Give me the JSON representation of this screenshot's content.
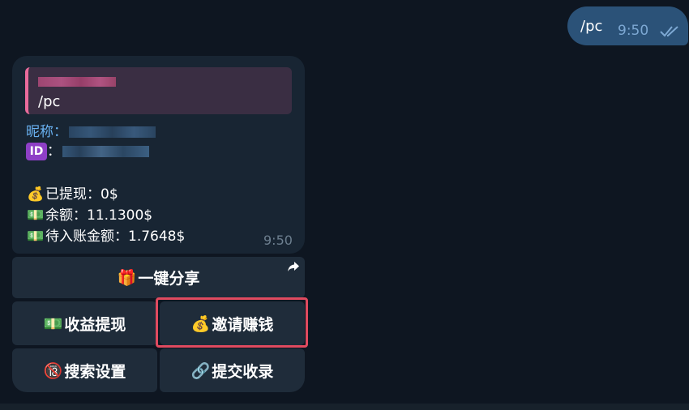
{
  "outgoing": {
    "text": "/pc",
    "time": "9:50"
  },
  "incoming": {
    "reply_text": "/pc",
    "nickname_label": "昵称：",
    "id_label": "：",
    "id_icon_text": "ID",
    "withdrawn": "已提现：0$",
    "balance": "余额：11.1300$",
    "pending": "待入账金额：1.7648$",
    "time": "9:50"
  },
  "buttons": {
    "share": "一键分享",
    "withdraw": "收益提现",
    "invite": "邀请赚钱",
    "search_settings": "搜索设置",
    "submit_record": "提交收录"
  },
  "icons": {
    "gift": "🎁",
    "money_bag": "💰",
    "money": "💵",
    "no_entry": "🔞",
    "link": "🔗"
  },
  "colors": {
    "bg": "#0e1621",
    "outgoing_bubble": "#2b5278",
    "incoming_bubble": "#182533",
    "button": "#1f2c3a",
    "highlight": "#e04a5f",
    "accent_link": "#6ab2f2"
  }
}
